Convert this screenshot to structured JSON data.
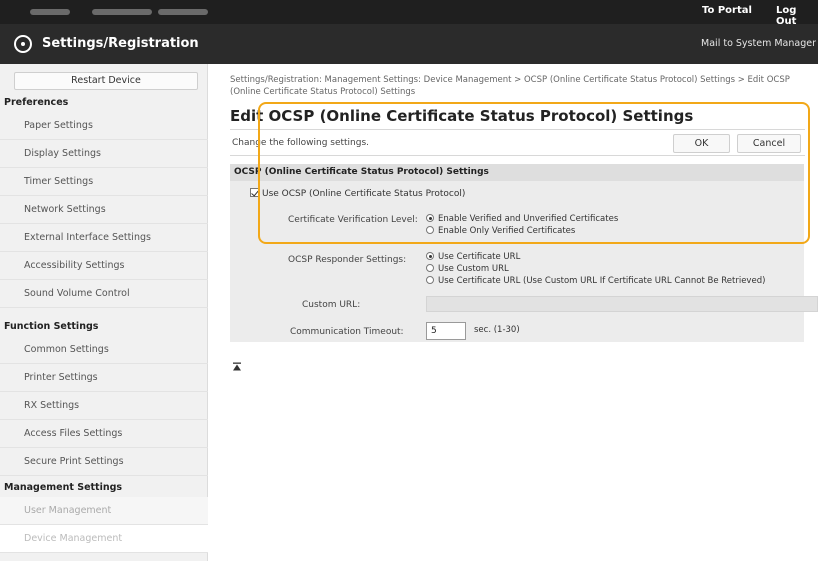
{
  "topbar": {
    "portal": "To Portal",
    "logout": "Log Out"
  },
  "header": {
    "title": "Settings/Registration",
    "mailto": "Mail to System Manager"
  },
  "sidebar": {
    "restart": "Restart Device",
    "sections": [
      {
        "title": "Preferences"
      },
      {
        "title": "Function Settings"
      },
      {
        "title": "Management Settings"
      }
    ],
    "items": [
      "Paper Settings",
      "Display Settings",
      "Timer Settings",
      "Network Settings",
      "External Interface Settings",
      "Accessibility Settings",
      "Sound Volume Control",
      "Common Settings",
      "Printer Settings",
      "RX Settings",
      "Access Files Settings",
      "Secure Print Settings",
      "User Management",
      "Device Management"
    ]
  },
  "main": {
    "breadcrumb": "Settings/Registration: Management Settings: Device Management > OCSP (Online Certificate Status Protocol) Settings > Edit OCSP (Online Certificate Status Protocol) Settings",
    "title": "Edit OCSP (Online Certificate Status Protocol) Settings",
    "instruction": "Change the following settings.",
    "ok": "OK",
    "cancel": "Cancel",
    "panel_title": "OCSP (Online Certificate Status Protocol) Settings",
    "use_ocsp": "Use OCSP (Online Certificate Status Protocol)",
    "verif_label": "Certificate Verification Level:",
    "verif_opt1": "Enable Verified and Unverified Certificates",
    "verif_opt2": "Enable Only Verified Certificates",
    "resp_label": "OCSP Responder Settings:",
    "resp_opt1": "Use Certificate URL",
    "resp_opt2": "Use Custom URL",
    "resp_opt3": "Use Certificate URL (Use Custom URL If Certificate URL Cannot Be Retrieved)",
    "url_label": "Custom URL:",
    "url_value": "",
    "timeout_label": "Communication Timeout:",
    "timeout_value": "5",
    "timeout_unit": "sec. (1-30)"
  },
  "colors": {
    "highlight": "#f2a818",
    "header": "#2b2b2b",
    "topbar": "#1f1f1f"
  }
}
